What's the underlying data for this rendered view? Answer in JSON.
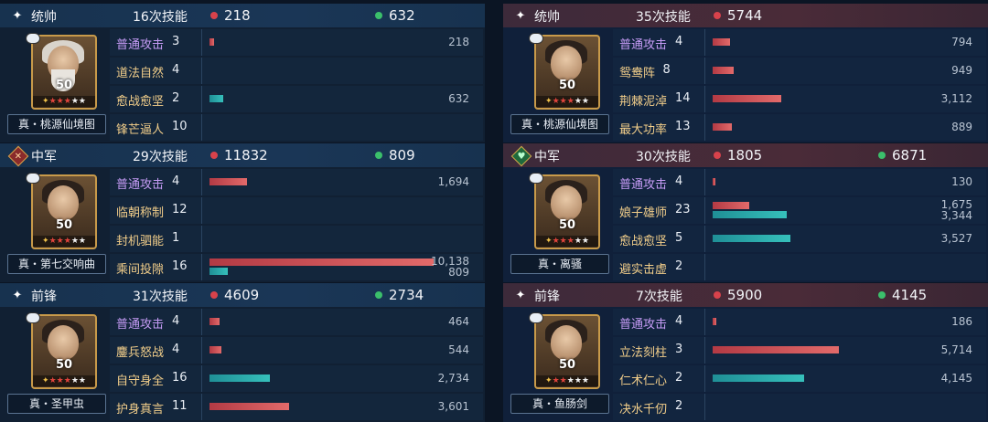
{
  "colors": {
    "damage": "#d8424b",
    "heal": "#3bbf6b",
    "bar_damage": "#e26a6a",
    "bar_heal": "#36c0bb",
    "skill_normal": "#c69cf6",
    "skill_tactic": "#f2ce8a"
  },
  "max_bar_value": 12000,
  "panels": [
    {
      "side": "ally",
      "role_icon": "star-icon",
      "role": "统帅",
      "skills_text": "16次技能",
      "damage": "218",
      "heal": "632",
      "level": "50",
      "stars": {
        "red": 3,
        "white": 2
      },
      "name": "真・桃源仙境图",
      "rows": [
        {
          "skill": "普通攻击",
          "count": "3",
          "type": "normal",
          "dmg": 218,
          "heal": null,
          "dmg_text": "218",
          "heal_text": ""
        },
        {
          "skill": "道法自然",
          "count": "4",
          "type": "tactic",
          "dmg": null,
          "heal": null,
          "dmg_text": "",
          "heal_text": ""
        },
        {
          "skill": "愈战愈坚",
          "count": "2",
          "type": "tactic",
          "dmg": null,
          "heal": 632,
          "dmg_text": "",
          "heal_text": "632"
        },
        {
          "skill": "锋芒逼人",
          "count": "10",
          "type": "tactic",
          "dmg": null,
          "heal": null,
          "dmg_text": "",
          "heal_text": ""
        }
      ]
    },
    {
      "side": "ally",
      "role_icon": "sword-icon",
      "role": "中军",
      "skills_text": "29次技能",
      "damage": "11832",
      "heal": "809",
      "level": "50",
      "stars": {
        "red": 3,
        "white": 2
      },
      "name": "真・第七交响曲",
      "rows": [
        {
          "skill": "普通攻击",
          "count": "4",
          "type": "normal",
          "dmg": 1694,
          "heal": null,
          "dmg_text": "1,694",
          "heal_text": ""
        },
        {
          "skill": "临朝称制",
          "count": "12",
          "type": "tactic",
          "dmg": null,
          "heal": null,
          "dmg_text": "",
          "heal_text": ""
        },
        {
          "skill": "封机驷能",
          "count": "1",
          "type": "tactic",
          "dmg": null,
          "heal": null,
          "dmg_text": "",
          "heal_text": ""
        },
        {
          "skill": "乘间投隙",
          "count": "16",
          "type": "tactic",
          "dmg": 10138,
          "heal": 809,
          "dmg_text": "10,138",
          "heal_text": "809"
        }
      ]
    },
    {
      "side": "ally",
      "role_icon": "star-icon",
      "role": "前锋",
      "skills_text": "31次技能",
      "damage": "4609",
      "heal": "2734",
      "level": "50",
      "stars": {
        "red": 3,
        "white": 2
      },
      "name": "真・圣甲虫",
      "rows": [
        {
          "skill": "普通攻击",
          "count": "4",
          "type": "normal",
          "dmg": 464,
          "heal": null,
          "dmg_text": "464",
          "heal_text": ""
        },
        {
          "skill": "鏖兵怒战",
          "count": "4",
          "type": "tactic",
          "dmg": 544,
          "heal": null,
          "dmg_text": "544",
          "heal_text": ""
        },
        {
          "skill": "自守身全",
          "count": "16",
          "type": "tactic",
          "dmg": null,
          "heal": 2734,
          "dmg_text": "",
          "heal_text": "2,734"
        },
        {
          "skill": "护身真言",
          "count": "11",
          "type": "tactic",
          "dmg": 3601,
          "heal": null,
          "dmg_text": "3,601",
          "heal_text": ""
        }
      ]
    },
    {
      "side": "enemy",
      "role_icon": "star-icon",
      "role": "统帅",
      "skills_text": "35次技能",
      "damage": "5744",
      "heal": "",
      "level": "50",
      "stars": {
        "red": 3,
        "white": 2
      },
      "name": "真・桃源仙境图",
      "rows": [
        {
          "skill": "普通攻击",
          "count": "4",
          "type": "normal",
          "dmg": 794,
          "heal": null,
          "dmg_text": "794",
          "heal_text": ""
        },
        {
          "skill": "鸳鸯阵",
          "count": "8",
          "type": "tactic",
          "dmg": 949,
          "heal": null,
          "dmg_text": "949",
          "heal_text": ""
        },
        {
          "skill": "荆棘泥淖",
          "count": "14",
          "type": "tactic",
          "dmg": 3112,
          "heal": null,
          "dmg_text": "3,112",
          "heal_text": ""
        },
        {
          "skill": "最大功率",
          "count": "13",
          "type": "tactic",
          "dmg": 889,
          "heal": null,
          "dmg_text": "889",
          "heal_text": ""
        }
      ]
    },
    {
      "side": "enemy",
      "role_icon": "heart-icon",
      "role": "中军",
      "skills_text": "30次技能",
      "damage": "1805",
      "heal": "6871",
      "level": "50",
      "stars": {
        "red": 3,
        "white": 2
      },
      "name": "真・离骚",
      "rows": [
        {
          "skill": "普通攻击",
          "count": "4",
          "type": "normal",
          "dmg": 130,
          "heal": null,
          "dmg_text": "130",
          "heal_text": ""
        },
        {
          "skill": "娘子雄师",
          "count": "23",
          "type": "tactic",
          "dmg": 1675,
          "heal": 3344,
          "dmg_text": "1,675",
          "heal_text": "3,344"
        },
        {
          "skill": "愈战愈坚",
          "count": "5",
          "type": "tactic",
          "dmg": null,
          "heal": 3527,
          "dmg_text": "",
          "heal_text": "3,527"
        },
        {
          "skill": "避实击虚",
          "count": "2",
          "type": "tactic",
          "dmg": null,
          "heal": null,
          "dmg_text": "",
          "heal_text": ""
        }
      ]
    },
    {
      "side": "enemy",
      "role_icon": "star-icon",
      "role": "前锋",
      "skills_text": "7次技能",
      "damage": "5900",
      "heal": "4145",
      "level": "50",
      "stars": {
        "red": 2,
        "white": 3
      },
      "name": "真・鱼肠剑",
      "rows": [
        {
          "skill": "普通攻击",
          "count": "4",
          "type": "normal",
          "dmg": 186,
          "heal": null,
          "dmg_text": "186",
          "heal_text": ""
        },
        {
          "skill": "立法刻柱",
          "count": "3",
          "type": "tactic",
          "dmg": 5714,
          "heal": null,
          "dmg_text": "5,714",
          "heal_text": ""
        },
        {
          "skill": "仁术仁心",
          "count": "2",
          "type": "tactic",
          "dmg": null,
          "heal": 4145,
          "dmg_text": "",
          "heal_text": "4,145"
        },
        {
          "skill": "决水千仞",
          "count": "2",
          "type": "tactic",
          "dmg": null,
          "heal": null,
          "dmg_text": "",
          "heal_text": ""
        }
      ]
    }
  ]
}
